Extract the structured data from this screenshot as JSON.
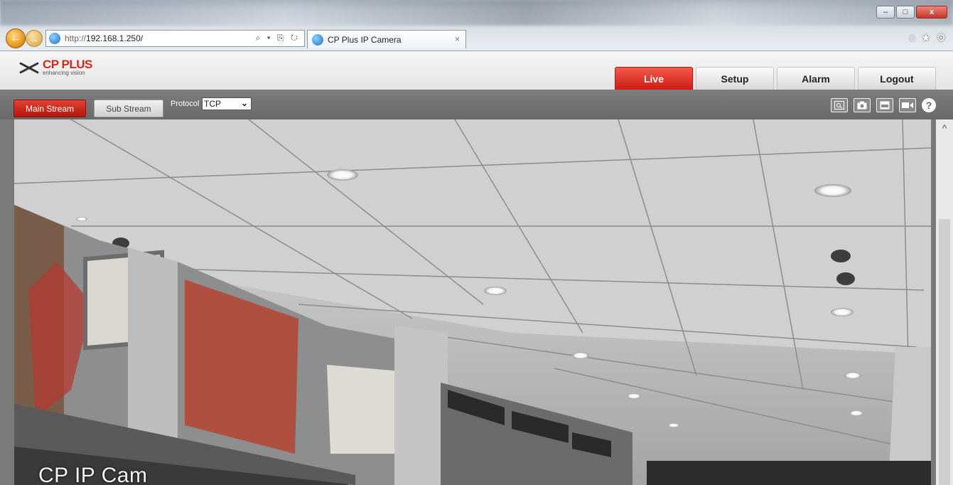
{
  "browser": {
    "url_protocol": "http://",
    "url_host": "192.168.1.250/",
    "address_tools": "⌕ ▾ ⎘ ↻",
    "tab_title": "CP Plus IP Camera",
    "tab_close": "×",
    "win_min": "–",
    "win_max": "□",
    "win_close": "x"
  },
  "app": {
    "brand": "CP PLUS",
    "tagline": "enhancing vision",
    "nav": [
      "Live",
      "Setup",
      "Alarm",
      "Logout"
    ],
    "active_nav": "Live"
  },
  "toolbar": {
    "main_stream": "Main Stream",
    "sub_stream": "Sub Stream",
    "protocol_label": "Protocol",
    "protocol_value": "TCP",
    "protocol_chevron": "⌄",
    "icons": [
      "zoom-icon",
      "snapshot-icon",
      "display-icon",
      "record-icon",
      "help-icon"
    ],
    "help_glyph": "?"
  },
  "video": {
    "osd_text": "CP IP Cam",
    "scroll_up": "^"
  },
  "colors": {
    "accent_red": "#cd1c12",
    "toolbar_gray": "#6a6a6a",
    "header_gray": "#e4e4e4"
  }
}
